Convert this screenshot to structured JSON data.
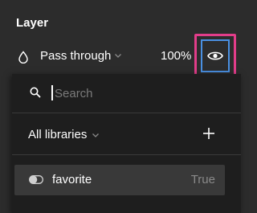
{
  "panel": {
    "title": "Layer",
    "blend_mode": "Pass through",
    "opacity": "100%"
  },
  "dropdown": {
    "search_placeholder": "Search",
    "search_value": "",
    "library_filter": "All libraries",
    "variables": [
      {
        "name": "favorite",
        "value": "True",
        "type_icon": "boolean-toggle-icon"
      }
    ]
  },
  "icons": {
    "blend": "drop-icon",
    "visibility": "eye-icon",
    "search": "search-icon",
    "add": "plus-icon",
    "chevron": "chevron-down-icon"
  },
  "colors": {
    "panel_bg": "#2c2c2c",
    "dropdown_bg": "#1e1e1e",
    "selected_row_bg": "#393939",
    "highlight_pink": "#e23d8a",
    "focus_blue": "#4a90e2",
    "muted_text": "#8a8a8a"
  }
}
